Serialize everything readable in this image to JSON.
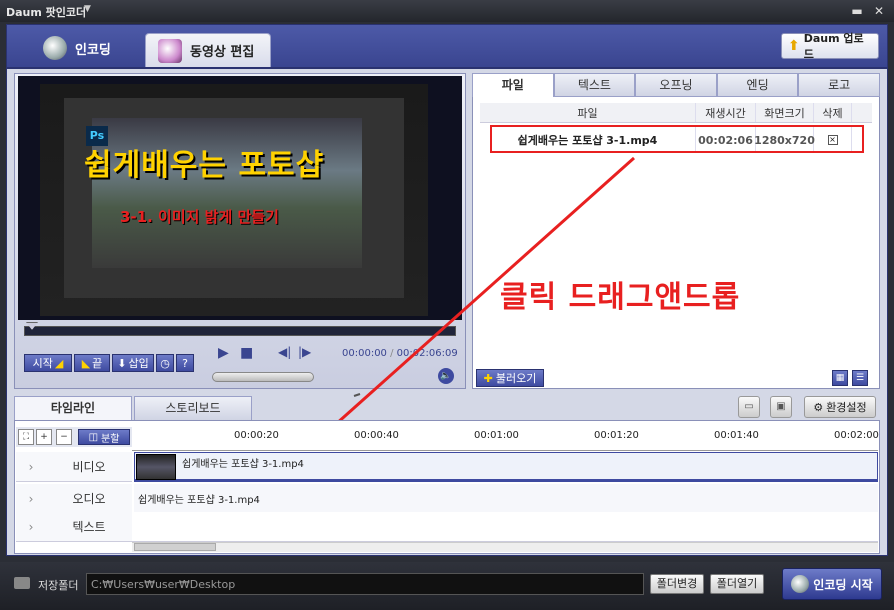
{
  "app": {
    "title": "Daum 팟인코더"
  },
  "nav": {
    "encode_tab": "인코딩",
    "edit_tab": "동영상 편집",
    "upload_button": "Daum 업로드"
  },
  "preview": {
    "video_title": "쉽게배우는 포토샵",
    "video_subtitle": "3-1. 이미지 밝게 만들기",
    "ps_logo": "Ps",
    "buttons": {
      "start": "시작",
      "end": "끝",
      "insert": "삽입",
      "help": "?"
    },
    "time_current": "00:00:00",
    "time_separator": "/",
    "time_total": "00:02:06:09"
  },
  "file_panel": {
    "tabs": [
      "파일",
      "텍스트",
      "오프닝",
      "엔딩",
      "로고"
    ],
    "headers": {
      "file": "파일",
      "duration": "재생시간",
      "size": "화면크기",
      "delete": "삭제"
    },
    "rows": [
      {
        "file": "쉽게배우는 포토샵 3-1.mp4",
        "duration": "00:02:06",
        "size": "1280x720",
        "delete": "×"
      }
    ],
    "load_button": "불러오기"
  },
  "annotation": {
    "drag_label": "클릭 드래그앤드롭"
  },
  "timeline": {
    "tabs": {
      "timeline": "타임라인",
      "storyboard": "스토리보드"
    },
    "settings_button": "환경설정",
    "split_button": "분할",
    "ticks": [
      "00:00:20",
      "00:00:40",
      "00:01:00",
      "00:01:20",
      "00:01:40",
      "00:02:00"
    ],
    "tracks": {
      "video": "비디오",
      "audio": "오디오",
      "text": "텍스트"
    },
    "video_clip_label": "쉽게배우는 포토샵 3-1.mp4",
    "audio_clip_label": "쉽게배우는 포토샵 3-1.mp4"
  },
  "bottom": {
    "folder_label": "저장폴더",
    "folder_path": "C:₩Users₩user₩Desktop",
    "change_folder": "폴더변경",
    "open_folder": "폴더열기",
    "encode_start": "인코딩 시작"
  },
  "colors": {
    "accent": "#3e4aa0",
    "annotation_red": "#e82020",
    "title_yellow": "#ffd200"
  }
}
